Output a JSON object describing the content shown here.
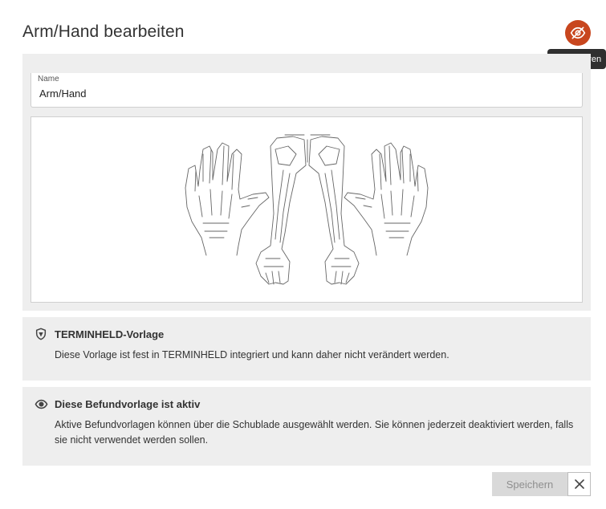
{
  "dialog": {
    "title": "Arm/Hand bearbeiten",
    "deactivate_icon": "eye-off-icon",
    "deactivate_tooltip": "Deaktivieren"
  },
  "name_field": {
    "label": "Name",
    "value": "Arm/Hand"
  },
  "template_notice": {
    "icon": "shield-icon",
    "title": "TERMINHELD-Vorlage",
    "text": "Diese Vorlage ist fest in TERMINHELD integriert und kann daher nicht verändert werden."
  },
  "active_notice": {
    "icon": "eye-icon",
    "title": "Diese Befundvorlage ist aktiv",
    "text": "Aktive Befundvorlagen können über die Schublade ausgewählt werden. Sie können jederzeit deaktiviert werden, falls sie nicht verwendet werden sollen."
  },
  "footer": {
    "save_label": "Speichern",
    "close_icon": "close-icon"
  },
  "colors": {
    "accent": "#c8461e",
    "panel": "#eeeeee",
    "tooltip": "#2f2f2f",
    "save_disabled": "#d9d9d9"
  }
}
